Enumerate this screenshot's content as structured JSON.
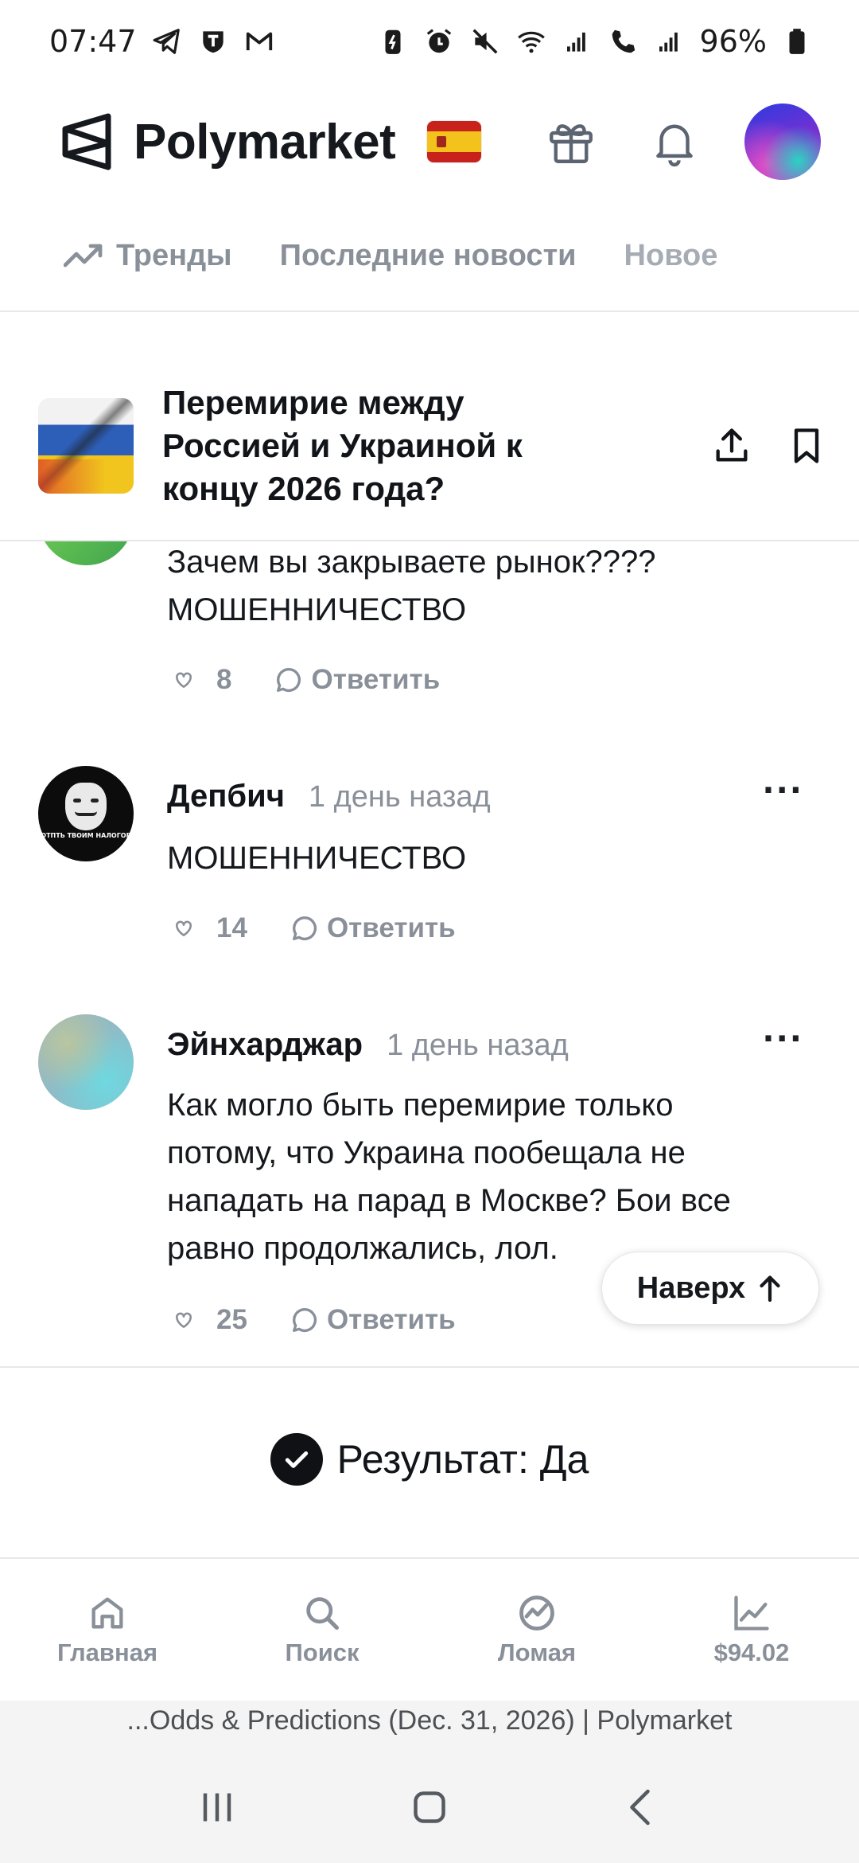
{
  "status_bar": {
    "time": "07:47",
    "battery": "96%",
    "left_icons": [
      "telegram-icon",
      "shield-app-icon",
      "gmail-icon"
    ],
    "right_icons": [
      "battery-saver-icon",
      "alarm-icon",
      "mute-icon",
      "wifi-icon",
      "signal-icon",
      "wifi-call-icon",
      "signal-2-icon",
      "battery-icon"
    ]
  },
  "header": {
    "logo_text": "Polymarket",
    "flag": "spain-flag",
    "icons": [
      "gift-icon",
      "bell-icon",
      "profile-avatar"
    ]
  },
  "tabs": [
    {
      "label": "Тренды",
      "icon": "trending-icon"
    },
    {
      "label": "Последние новости"
    },
    {
      "label": "Новое"
    }
  ],
  "market": {
    "title": "Перемирие между Россией и Украиной к концу 2026 года?",
    "actions": [
      "share-icon",
      "bookmark-icon"
    ]
  },
  "comments": [
    {
      "text_lines": [
        "Зачем вы закрываете рынок????",
        "МОШЕННИЧЕСТВО"
      ],
      "likes": "8",
      "reply_label": "Ответить"
    },
    {
      "author": "Депбич",
      "time": "1 день назад",
      "text_lines": [
        "МОШЕННИЧЕСТВО"
      ],
      "likes": "14",
      "reply_label": "Ответить",
      "avatar_text": "ОТПТЬ ТВОИМ НАЛОГОВ"
    },
    {
      "author": "Эйнхарджар",
      "time": "1 день назад",
      "text_lines": [
        "Как могло быть перемирие только",
        "потому, что Украина пообещала не",
        "нападать на парад в Москве? Бои все",
        "равно продолжались, лол."
      ],
      "likes": "25",
      "reply_label": "Ответить"
    }
  ],
  "more_symbol": "···",
  "to_top_label": "Наверх",
  "result_label": "Результат: Да",
  "bottom_nav": [
    {
      "label": "Главная",
      "icon": "home-icon"
    },
    {
      "label": "Поиск",
      "icon": "search-icon"
    },
    {
      "label": "Ломая",
      "icon": "breaking-icon"
    },
    {
      "label": "$94.02",
      "icon": "portfolio-chart-icon"
    }
  ],
  "browser": {
    "page_title": "...Odds & Predictions (Dec. 31, 2026) | Polymarket"
  },
  "colors": {
    "text": "#111418",
    "muted": "#8a9099",
    "divider": "#e6e8eb"
  }
}
